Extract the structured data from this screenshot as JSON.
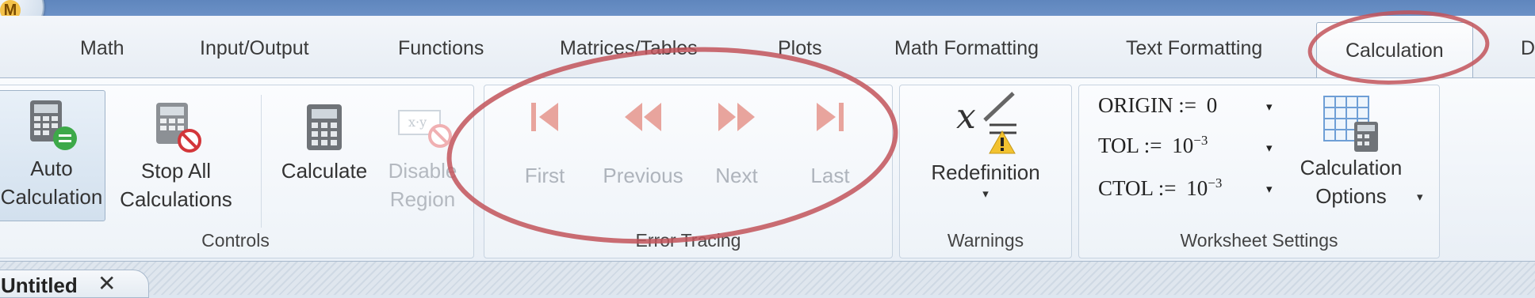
{
  "tabs": [
    {
      "label": "Math"
    },
    {
      "label": "Input/Output"
    },
    {
      "label": "Functions"
    },
    {
      "label": "Matrices/Tables"
    },
    {
      "label": "Plots"
    },
    {
      "label": "Math Formatting"
    },
    {
      "label": "Text Formatting"
    },
    {
      "label": "Calculation",
      "active": true
    },
    {
      "label": "D"
    }
  ],
  "groups": {
    "controls": {
      "label": "Controls",
      "auto_calc": {
        "line1": "Auto",
        "line2": "Calculation"
      },
      "stop_all": {
        "line1": "Stop All",
        "line2": "Calculations"
      },
      "calculate": {
        "label": "Calculate"
      },
      "disable_region": {
        "line1": "Disable",
        "line2": "Region"
      }
    },
    "error_tracing": {
      "label": "Error Tracing",
      "first": "First",
      "previous": "Previous",
      "next": "Next",
      "last": "Last"
    },
    "warnings": {
      "label": "Warnings",
      "redefinition": "Redefinition"
    },
    "worksheet_settings": {
      "label": "Worksheet Settings",
      "origin": {
        "name": "ORIGIN",
        "assign": ":=",
        "value": "0"
      },
      "tol": {
        "name": "TOL",
        "assign": ":=",
        "base": "10",
        "exponent": "−3"
      },
      "ctol": {
        "name": "CTOL",
        "assign": ":=",
        "base": "10",
        "exponent": "−3"
      },
      "calc_options": {
        "line1": "Calculation",
        "line2": "Options"
      }
    }
  },
  "document": {
    "tab_title": "Untitled"
  },
  "icons": {
    "app_logo_letter": "M",
    "close": "✕",
    "dropdown": "▾",
    "nav_first": "first-icon",
    "nav_previous": "previous-icon",
    "nav_next": "next-icon",
    "nav_last": "last-icon"
  },
  "colors": {
    "titlebar": "#6b91c6",
    "disabled_nav": "#e8a49d",
    "annotation": "#c2535a",
    "warning": "#f2c230"
  }
}
